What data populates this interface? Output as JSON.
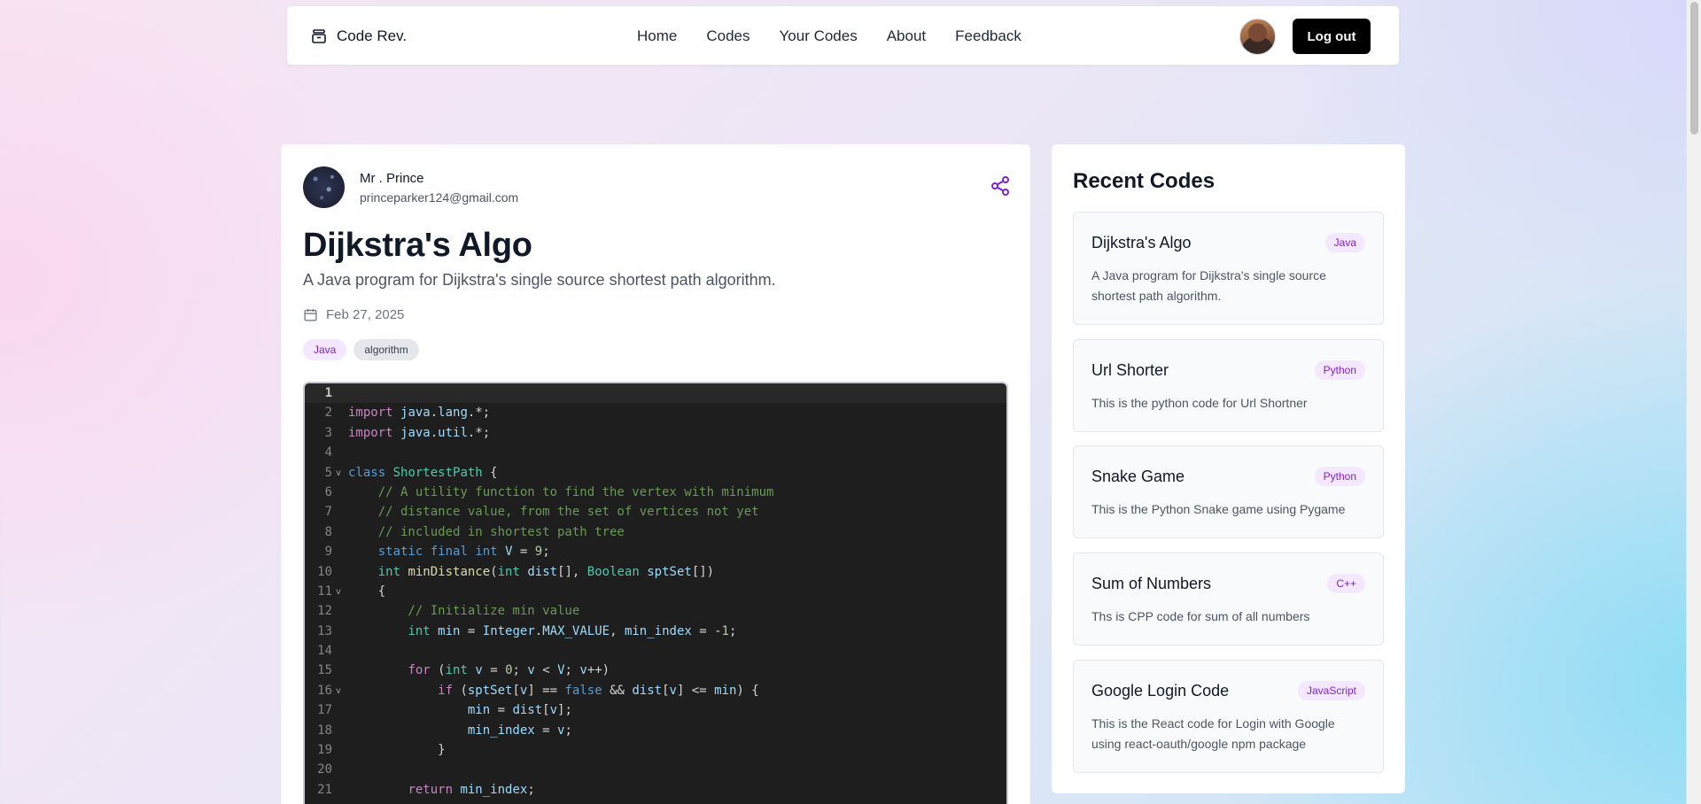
{
  "navbar": {
    "brand": "Code Rev.",
    "links": [
      "Home",
      "Codes",
      "Your Codes",
      "About",
      "Feedback"
    ],
    "logout_label": "Log out"
  },
  "post": {
    "author_name": "Mr . Prince",
    "author_email": "princeparker124@gmail.com",
    "title": "Dijkstra's Algo",
    "description": "A Java program for Dijkstra's single source shortest path algorithm.",
    "date": "Feb 27, 2025",
    "tags": [
      "Java",
      "algorithm"
    ],
    "code_lines": [
      "",
      "import java.lang.*;",
      "import java.util.*;",
      "",
      "class ShortestPath {",
      "    // A utility function to find the vertex with minimum",
      "    // distance value, from the set of vertices not yet",
      "    // included in shortest path tree",
      "    static final int V = 9;",
      "    int minDistance(int dist[], Boolean sptSet[])",
      "    {",
      "        // Initialize min value",
      "        int min = Integer.MAX_VALUE, min_index = -1;",
      "",
      "        for (int v = 0; v < V; v++)",
      "            if (sptSet[v] == false && dist[v] <= min) {",
      "                min = dist[v];",
      "                min_index = v;",
      "            }",
      "",
      "        return min_index;"
    ],
    "fold_lines": [
      5,
      11,
      16
    ],
    "active_line": 1
  },
  "sidebar": {
    "title": "Recent Codes",
    "items": [
      {
        "title": "Dijkstra's Algo",
        "lang": "Java",
        "desc": "A Java program for Dijkstra's single source shortest path algorithm."
      },
      {
        "title": "Url Shorter",
        "lang": "Python",
        "desc": "This is the python code for Url Shortner"
      },
      {
        "title": "Snake Game",
        "lang": "Python",
        "desc": "This is the Python Snake game using Pygame"
      },
      {
        "title": "Sum of Numbers",
        "lang": "C++",
        "desc": "Ths is CPP code for sum of all numbers"
      },
      {
        "title": "Google Login Code",
        "lang": "JavaScript",
        "desc": "This is the React code for Login with Google using react-oauth/google npm package"
      }
    ]
  },
  "icons": {
    "brand": "archive-box-icon",
    "share": "share-icon",
    "date": "calendar-icon",
    "fold": "chevron-down-icon"
  },
  "colors": {
    "accent": "#7e22ce",
    "badge_bg": "#f3e8ff",
    "button_bg": "#000000",
    "code_bg": "#1e1e1e"
  }
}
